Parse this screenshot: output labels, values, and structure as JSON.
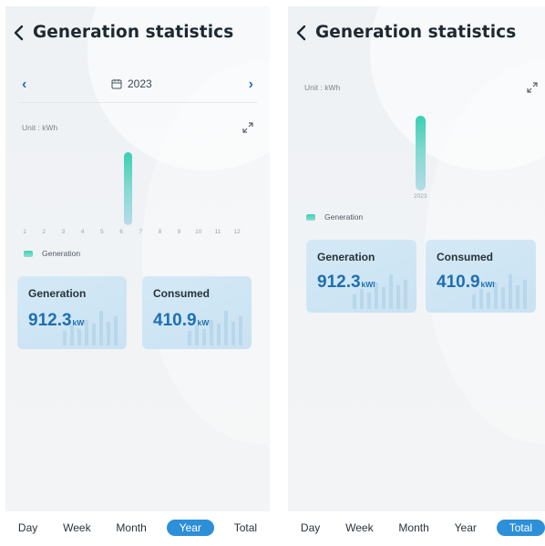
{
  "left": {
    "title": "Generation statistics",
    "year": "2023",
    "unit": "Unit : kWh",
    "month_ticks": [
      "1",
      "2",
      "3",
      "4",
      "5",
      "6",
      "7",
      "8",
      "9",
      "10",
      "11",
      "12"
    ],
    "legend": "Generation",
    "cards": [
      {
        "label": "Generation",
        "value": "912.3",
        "unit": "kWh"
      },
      {
        "label": "Consumed",
        "value": "410.9",
        "unit": "kWh"
      }
    ],
    "tabs": [
      "Day",
      "Week",
      "Month",
      "Year",
      "Total"
    ],
    "active_tab": "Year"
  },
  "right": {
    "title": "Generation statistics",
    "unit": "Unit : kWh",
    "x_tick": "2023",
    "legend": "Generation",
    "cards": [
      {
        "label": "Generation",
        "value": "912.3",
        "unit": "kWh"
      },
      {
        "label": "Consumed",
        "value": "410.9",
        "unit": "kWh"
      }
    ],
    "tabs": [
      "Day",
      "Week",
      "Month",
      "Year",
      "Total"
    ],
    "active_tab": "Total"
  },
  "colors": {
    "accent": "#2d8fd8",
    "bar_top": "#38d0b2",
    "card_bg": "#d4e9f6",
    "value_text": "#1f6fb0"
  },
  "icons": [
    "back-icon",
    "calendar-icon",
    "chevron-left-icon",
    "chevron-right-icon",
    "expand-icon"
  ]
}
